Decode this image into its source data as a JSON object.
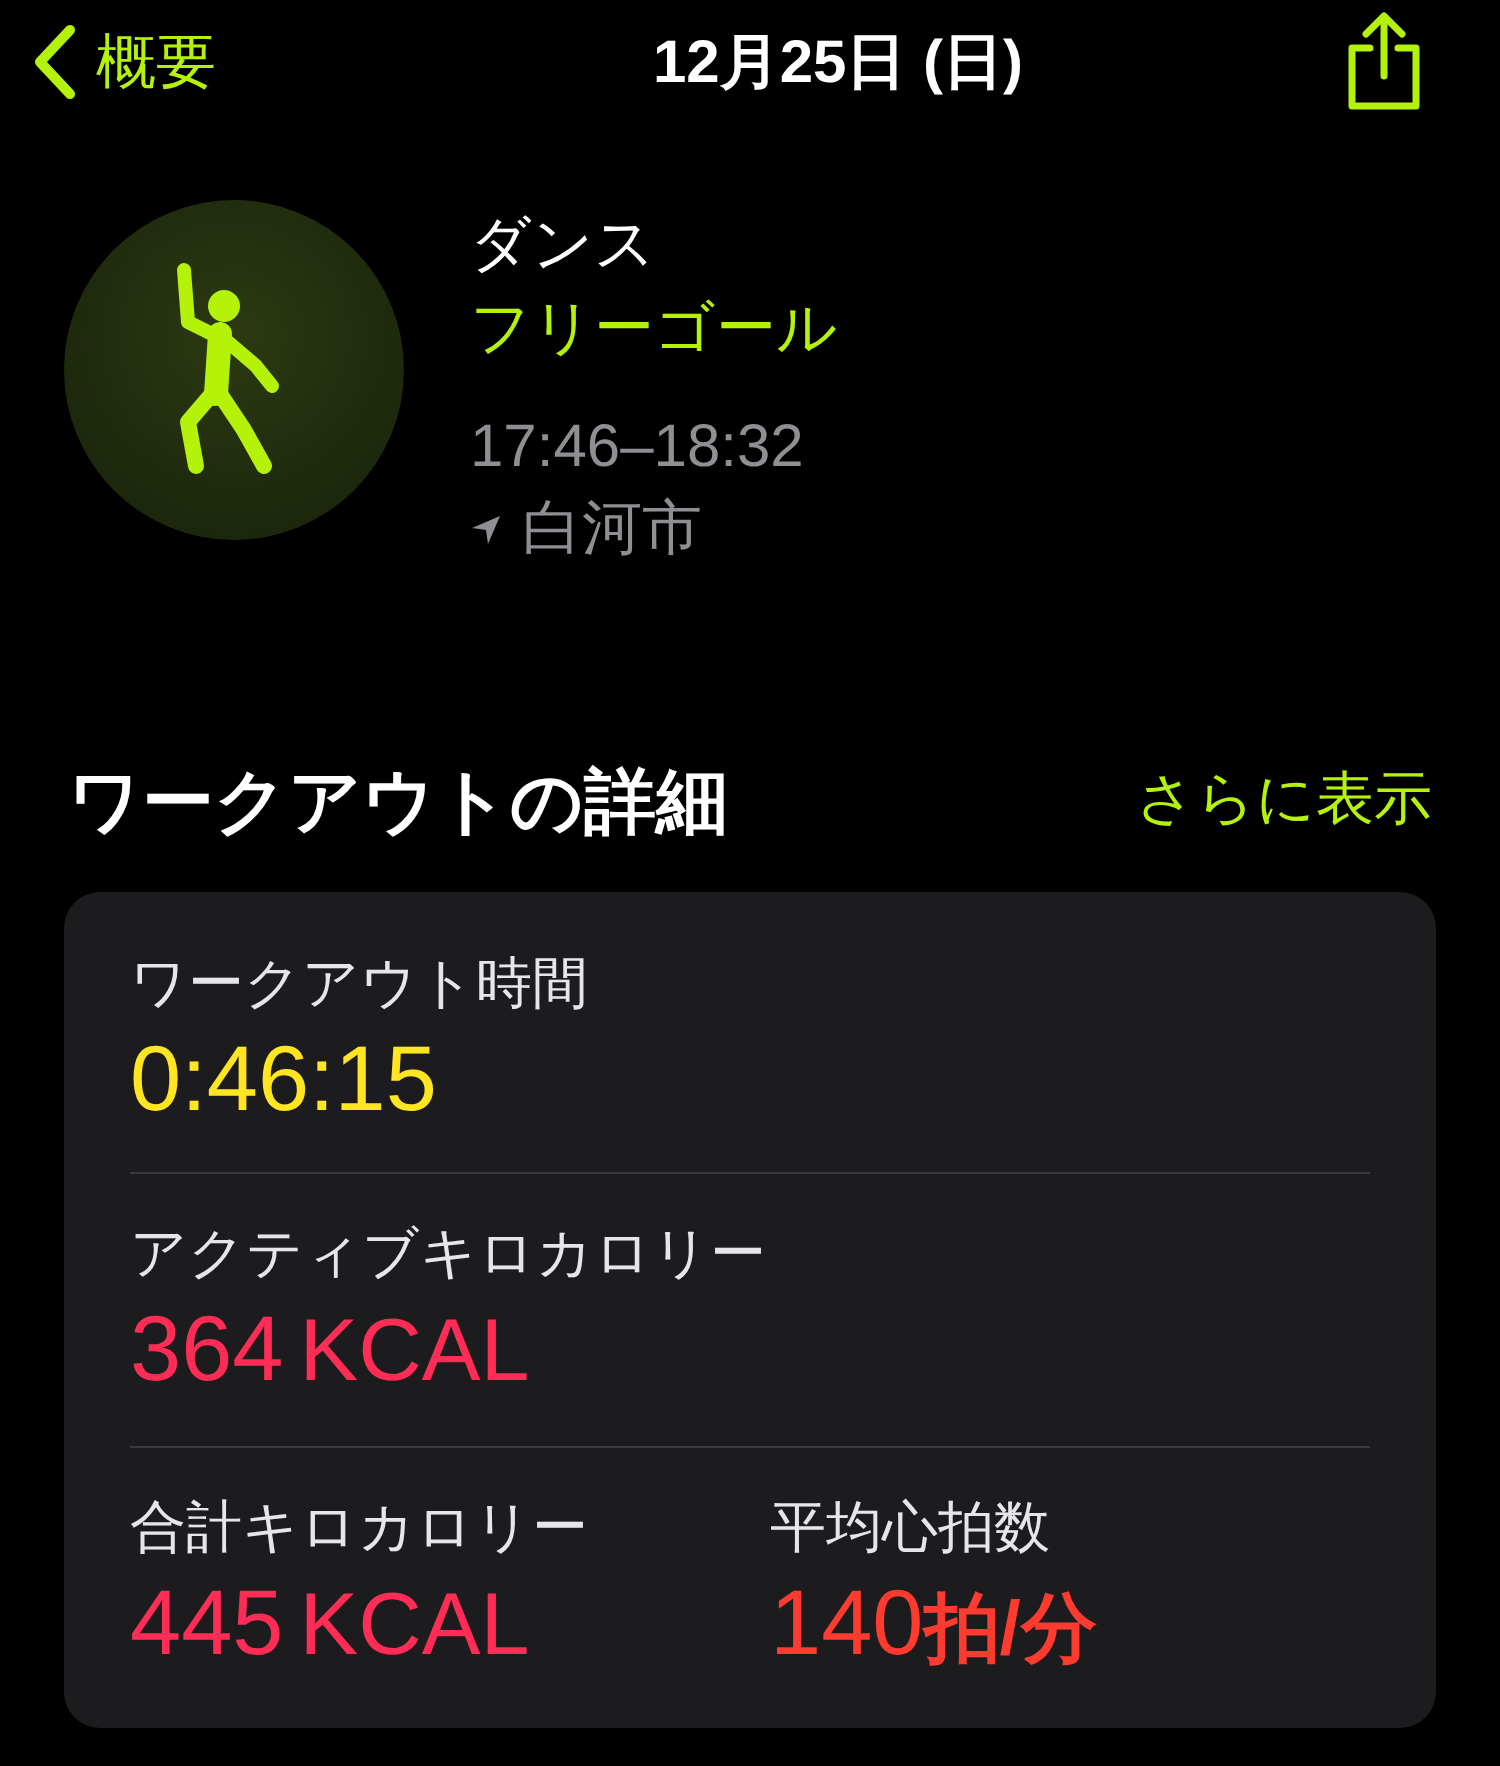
{
  "nav": {
    "back": "概要",
    "title": "12月25日 (日)"
  },
  "workout": {
    "type": "ダンス",
    "goal": "フリーゴール",
    "time": "17:46–18:32",
    "location": "白河市"
  },
  "details": {
    "title": "ワークアウトの詳細",
    "more": "さらに表示",
    "rows": [
      [
        {
          "label": "ワークアウト時間",
          "value": "0:46:15",
          "color": "#ffe620"
        }
      ],
      [
        {
          "label": "アクティブキロカロリー",
          "value": "364",
          "unit": "KCAL",
          "color": "#ff2d55"
        }
      ],
      [
        {
          "label": "合計キロカロリー",
          "value": "445",
          "unit": "KCAL",
          "color": "#ff2d55"
        },
        {
          "label": "平均心拍数",
          "value": "140",
          "unit": "拍/分",
          "color": "#ff3b30"
        }
      ]
    ]
  }
}
